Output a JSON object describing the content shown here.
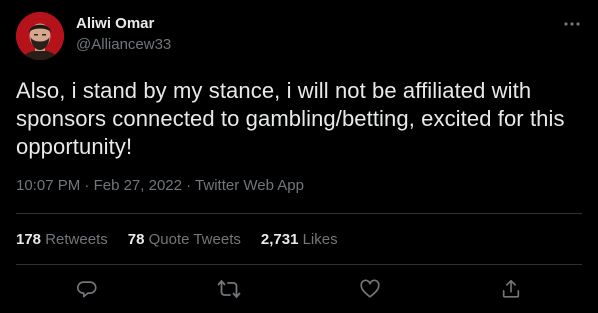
{
  "colors": {
    "background": "#000000",
    "text_primary": "#e7e9ea",
    "text_secondary": "#71767b",
    "divider": "#2f3336",
    "avatar_background": "#b5121b"
  },
  "author": {
    "display_name": "Aliwi Omar",
    "handle": "@Alliancew33"
  },
  "tweet": {
    "text": "Also, i stand by my stance, i will not be affiliated with sponsors connected to gambling/betting, excited for this opportunity!",
    "time": "10:07 PM",
    "date": "Feb 27, 2022",
    "source": "Twitter Web App",
    "separator": "·"
  },
  "stats": {
    "retweets": {
      "count": "178",
      "label": "Retweets"
    },
    "quote_tweets": {
      "count": "78",
      "label": "Quote Tweets"
    },
    "likes": {
      "count": "2,731",
      "label": "Likes"
    }
  },
  "actions": {
    "reply_icon": "reply-icon",
    "retweet_icon": "retweet-icon",
    "like_icon": "heart-icon",
    "share_icon": "share-icon",
    "more_icon": "more-icon"
  }
}
